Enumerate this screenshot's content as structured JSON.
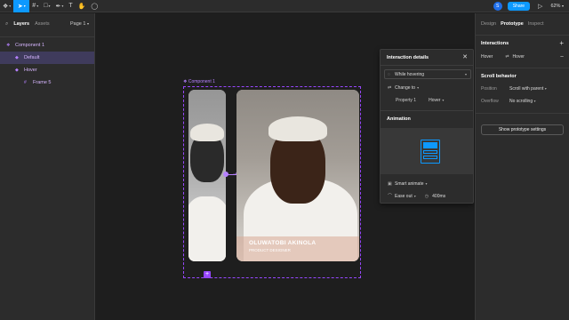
{
  "toolbar": {
    "zoom": "62%",
    "share_label": "Share",
    "avatar_initial": "S"
  },
  "left_panel": {
    "tabs": [
      "Layers",
      "Assets"
    ],
    "page": "Page 1",
    "layers": [
      {
        "label": "Component 1"
      },
      {
        "label": "Default"
      },
      {
        "label": "Hover"
      },
      {
        "label": "Frame 5"
      }
    ]
  },
  "canvas": {
    "component_label": "Component 1",
    "card": {
      "name": "OLUWATOBI AKINOLA",
      "role": "PRODUCT DESIGNER"
    }
  },
  "interaction_popup": {
    "title": "Interaction details",
    "trigger": "While hovering",
    "action": "Change to",
    "property_label": "Property 1",
    "property_value": "Hover",
    "animation_title": "Animation",
    "animation_type": "Smart animate",
    "easing": "Ease out",
    "duration": "400ms",
    "accent_color": "#0d99ff"
  },
  "right_panel": {
    "tabs": [
      "Design",
      "Prototype",
      "Inspect"
    ],
    "interactions_title": "Interactions",
    "interaction": {
      "trigger": "Hover",
      "target": "Hover"
    },
    "scroll_behavior_title": "Scroll behavior",
    "position_label": "Position",
    "position_value": "Scroll with parent",
    "overflow_label": "Overflow",
    "overflow_value": "No scrolling",
    "settings_button": "Show prototype settings"
  }
}
